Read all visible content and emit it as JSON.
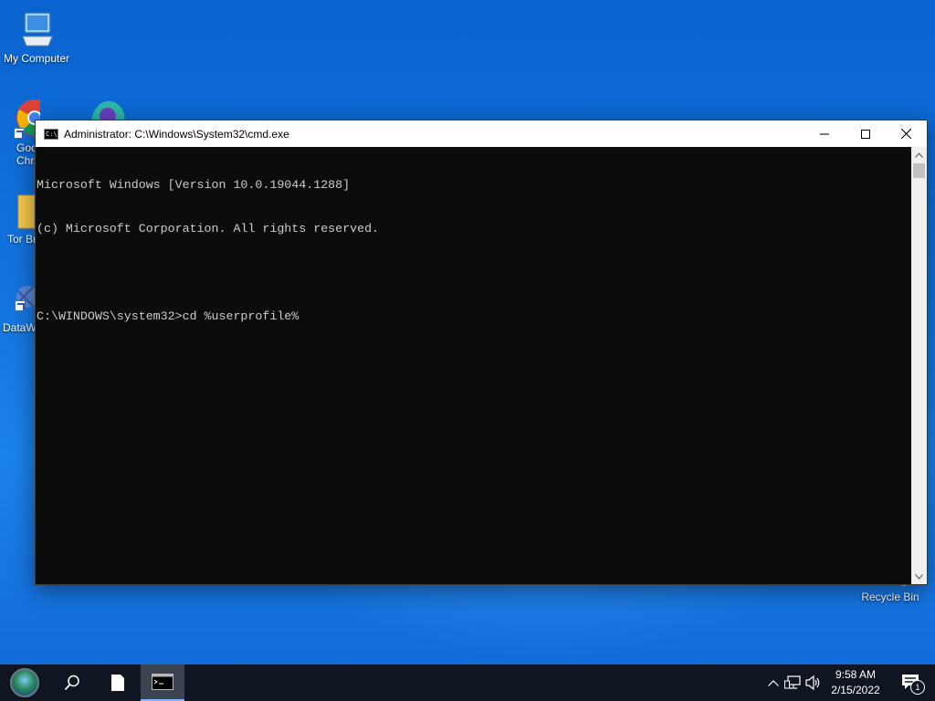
{
  "desktop": {
    "icons": [
      {
        "label": "My Computer"
      },
      {
        "label": "Goo\nChr"
      },
      {
        "label": ""
      },
      {
        "label": "Tor Br"
      },
      {
        "label": "DataW"
      },
      {
        "label": "Recycle Bin"
      }
    ]
  },
  "window": {
    "title": "Administrator: C:\\Windows\\System32\\cmd.exe",
    "console_lines": [
      "Microsoft Windows [Version 10.0.19044.1288]",
      "(c) Microsoft Corporation. All rights reserved.",
      "",
      "C:\\WINDOWS\\system32>cd %userprofile%"
    ]
  },
  "taskbar": {
    "time": "9:58 AM",
    "date": "2/15/2022",
    "notification_count": "1"
  },
  "colors": {
    "console_bg": "#0c0c0c",
    "console_text": "#cccccc",
    "taskbar_bg": "#101621"
  }
}
